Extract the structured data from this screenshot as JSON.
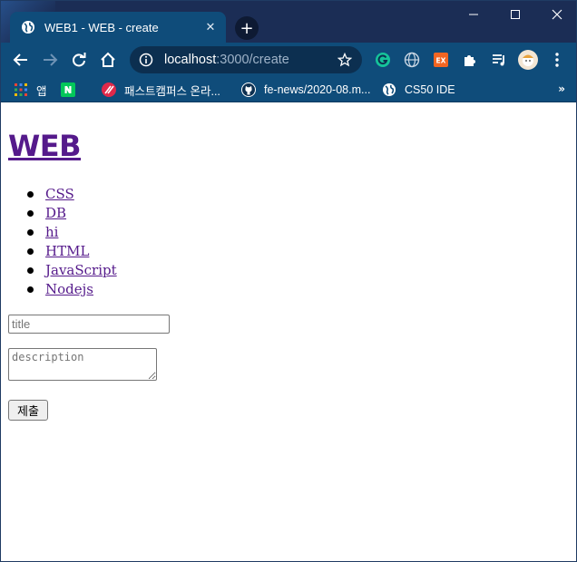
{
  "browser": {
    "tab_title": "WEB1 - WEB - create",
    "url_host": "localhost",
    "url_rest": ":3000/create",
    "bookmarks": [
      {
        "label": "앱",
        "icon": "apps-grid-icon"
      },
      {
        "label": "",
        "icon": "naver-icon"
      },
      {
        "label": "패스트캠퍼스 온라...",
        "icon": "fastcampus-icon"
      },
      {
        "label": "fe-news/2020-08.m...",
        "icon": "github-icon"
      },
      {
        "label": "CS50 IDE",
        "icon": "globe-icon"
      }
    ],
    "more_label": "»"
  },
  "page": {
    "heading": "WEB",
    "topics": [
      "CSS",
      "DB",
      "hi",
      "HTML",
      "JavaScript",
      "Nodejs"
    ],
    "title_placeholder": "title",
    "description_placeholder": "description",
    "submit_label": "제출"
  },
  "colors": {
    "titlebar": "#1b2d55",
    "toolbar": "#0f4c7a",
    "visited_link": "#551a8b"
  }
}
